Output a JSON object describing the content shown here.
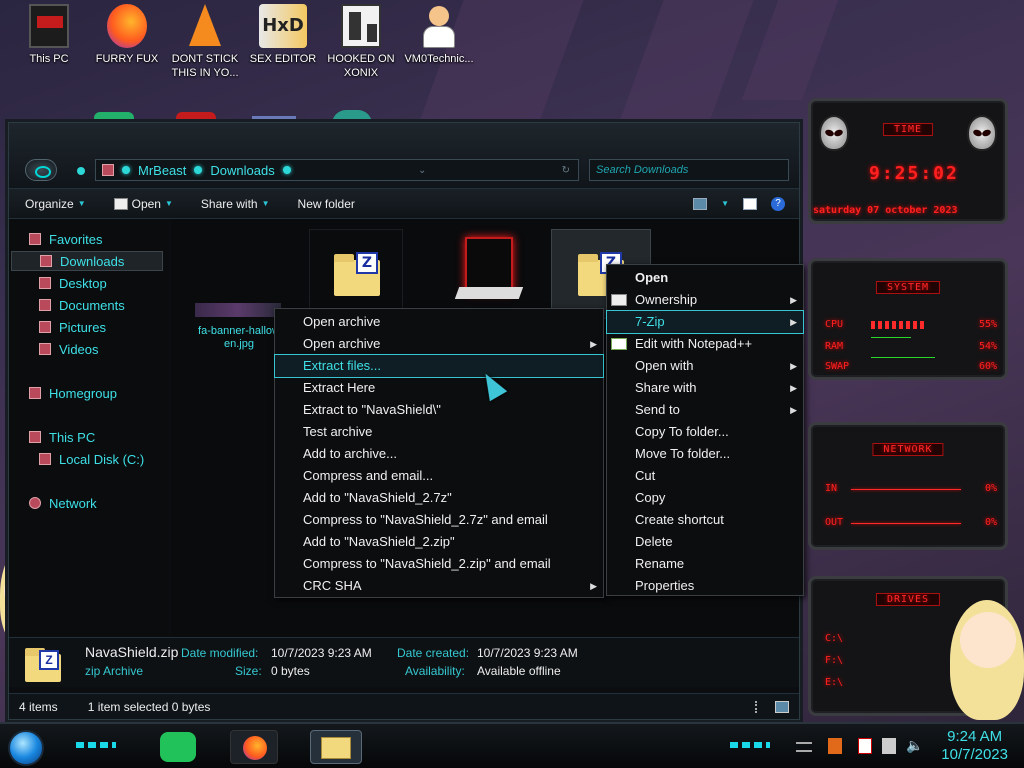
{
  "desktop": {
    "icons": [
      {
        "label_line1": "This PC",
        "label_line2": ""
      },
      {
        "label_line1": "FURRY FUX",
        "label_line2": ""
      },
      {
        "label_line1": "DONT STICK",
        "label_line2": "THIS IN YO..."
      },
      {
        "label_line1": "SEX EDITOR",
        "label_line2": ""
      },
      {
        "label_line1": "HOOKED ON",
        "label_line2": "XONIX"
      },
      {
        "label_line1": "VM0Technic...",
        "label_line2": ""
      }
    ]
  },
  "explorer": {
    "breadcrumb": [
      "MrBeast",
      "Downloads"
    ],
    "search_placeholder": "Search Downloads",
    "toolbar": {
      "organize": "Organize",
      "open": "Open",
      "share_with": "Share with",
      "new_folder": "New folder"
    },
    "nav": {
      "favorites": "Favorites",
      "downloads": "Downloads",
      "desktop": "Desktop",
      "documents": "Documents",
      "pictures": "Pictures",
      "videos": "Videos",
      "homegroup": "Homegroup",
      "this_pc": "This PC",
      "local_disk": "Local Disk (C:)",
      "network": "Network"
    },
    "files": {
      "jpg_name_line1": "fa-banner-hallow",
      "jpg_name_line2": "en.jpg"
    },
    "details": {
      "name": "NavaShield.zip",
      "type": "zip Archive",
      "date_modified_label": "Date modified:",
      "date_modified": "10/7/2023 9:23 AM",
      "size_label": "Size:",
      "size": "0 bytes",
      "date_created_label": "Date created:",
      "date_created": "10/7/2023 9:23 AM",
      "availability_label": "Availability:",
      "availability": "Available offline"
    },
    "status": {
      "items": "4 items",
      "selected": "1 item selected  0 bytes"
    }
  },
  "context_menu": {
    "items": [
      {
        "label": "Open",
        "bold": true,
        "submenu": false
      },
      {
        "label": "Ownership",
        "submenu": true
      },
      {
        "label": "7-Zip",
        "submenu": true,
        "highlighted": true
      },
      {
        "label": "Edit with Notepad++",
        "submenu": false
      },
      {
        "label": "Open with",
        "submenu": true
      },
      {
        "label": "Share with",
        "submenu": true
      },
      {
        "label": "Send to",
        "submenu": true
      },
      {
        "label": "Copy To folder...",
        "submenu": false
      },
      {
        "label": "Move To folder...",
        "submenu": false
      },
      {
        "label": "Cut",
        "submenu": false
      },
      {
        "label": "Copy",
        "submenu": false
      },
      {
        "label": "Create shortcut",
        "submenu": false
      },
      {
        "label": "Delete",
        "submenu": false
      },
      {
        "label": "Rename",
        "submenu": false
      },
      {
        "label": "Properties",
        "submenu": false
      }
    ]
  },
  "zip_submenu": {
    "items": [
      {
        "label": "Open archive",
        "submenu": false
      },
      {
        "label": "Open archive",
        "submenu": true
      },
      {
        "label": "Extract files...",
        "submenu": false,
        "highlighted": true
      },
      {
        "label": "Extract Here",
        "submenu": false
      },
      {
        "label": "Extract to \"NavaShield\\\"",
        "submenu": false
      },
      {
        "label": "Test archive",
        "submenu": false
      },
      {
        "label": "Add to archive...",
        "submenu": false
      },
      {
        "label": "Compress and email...",
        "submenu": false
      },
      {
        "label": "Add to \"NavaShield_2.7z\"",
        "submenu": false
      },
      {
        "label": "Compress to \"NavaShield_2.7z\" and email",
        "submenu": false
      },
      {
        "label": "Add to \"NavaShield_2.zip\"",
        "submenu": false
      },
      {
        "label": "Compress to \"NavaShield_2.zip\" and email",
        "submenu": false
      },
      {
        "label": "CRC SHA",
        "submenu": true
      }
    ]
  },
  "gadgets": {
    "time_title": "TIME",
    "time": "9:25:02",
    "date": "saturday 07 october 2023",
    "system_title": "SYSTEM",
    "cpu_label": "CPU",
    "cpu": "55%",
    "ram_label": "RAM",
    "ram": "54%",
    "swap_label": "SWAP",
    "swap": "60%",
    "network_title": "NETWORK",
    "in_label": "IN",
    "in": "0%",
    "out_label": "OUT",
    "out": "0%",
    "drives_title": "DRIVES",
    "drives": [
      "C:\\",
      "F:\\",
      "E:\\"
    ]
  },
  "taskbar": {
    "time": "9:24 AM",
    "date": "10/7/2023"
  },
  "colors": {
    "accent_cyan": "#3ee0e6",
    "gadget_red": "#ff2020",
    "menu_bg": "#0c0d0f"
  }
}
